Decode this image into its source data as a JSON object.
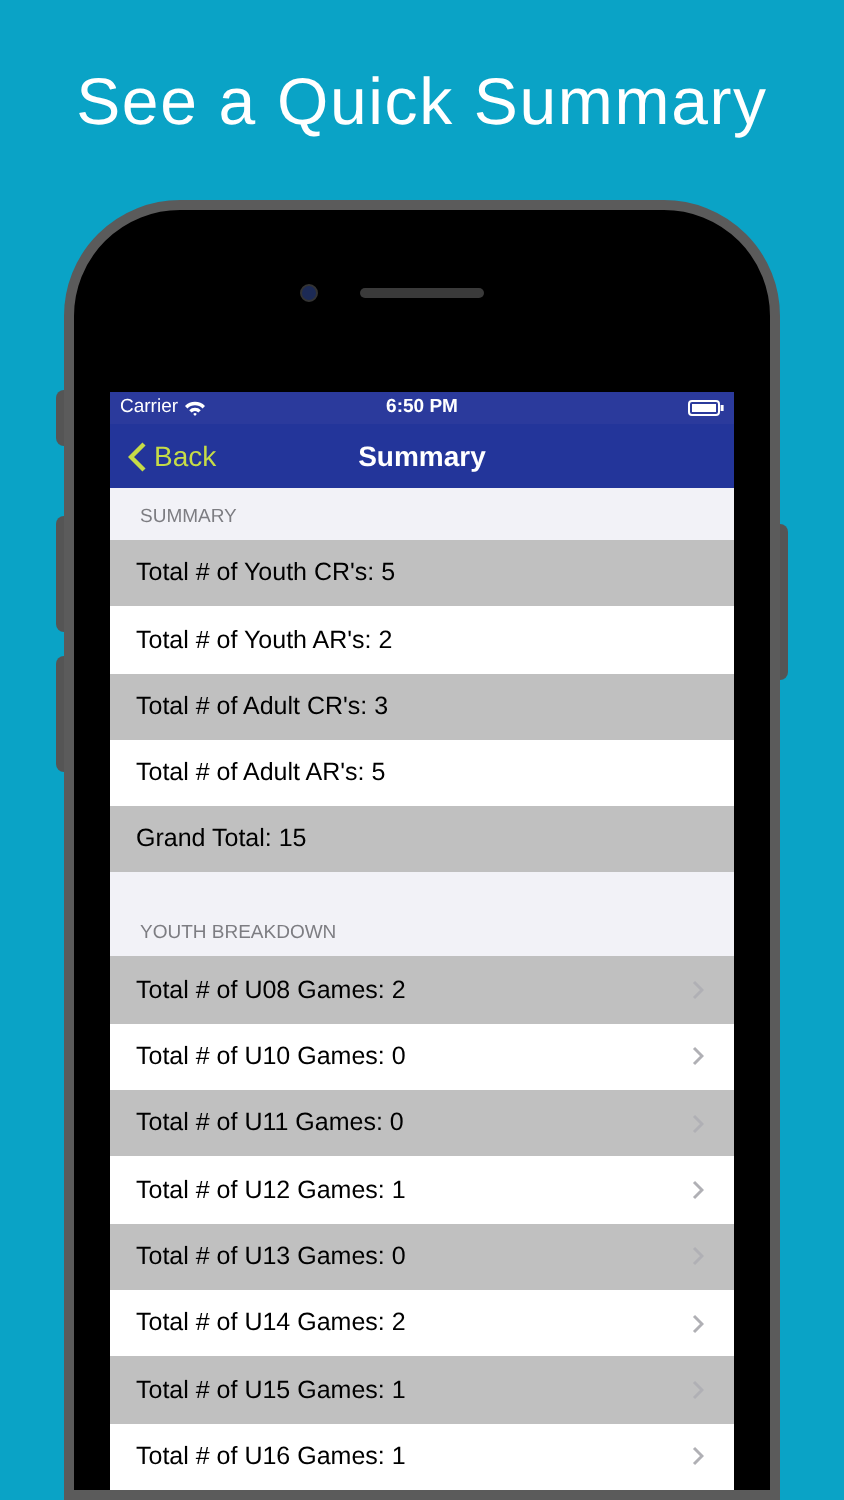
{
  "headline": "See a Quick Summary",
  "status_bar": {
    "carrier": "Carrier",
    "time": "6:50 PM"
  },
  "nav": {
    "back": "Back",
    "title": "Summary"
  },
  "sections": [
    {
      "kind": "summary",
      "header": "SUMMARY",
      "rows": [
        "Total # of Youth CR's: 5",
        "Total # of Youth AR's: 2",
        "Total # of Adult CR's: 3",
        "Total # of Adult AR's: 5",
        "Grand Total: 15"
      ]
    },
    {
      "kind": "breakdown",
      "header": "YOUTH BREAKDOWN",
      "rows": [
        "Total # of U08 Games: 2",
        "Total # of U10 Games: 0",
        "Total # of U11 Games: 0",
        "Total # of U12 Games: 1",
        "Total # of U13 Games: 0",
        "Total # of U14 Games: 2",
        "Total # of U15 Games: 1",
        "Total # of U16 Games: 1"
      ]
    }
  ]
}
